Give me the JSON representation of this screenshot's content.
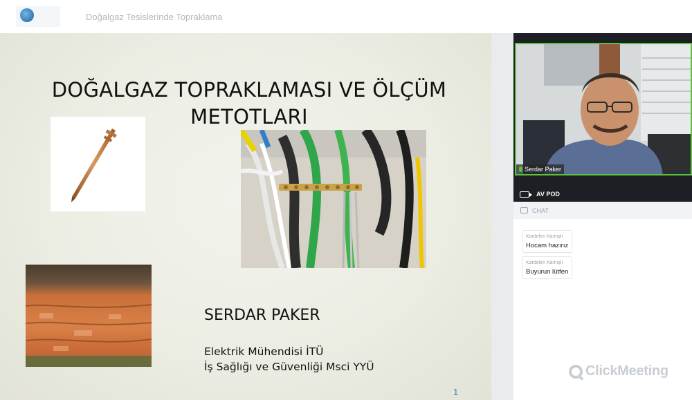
{
  "header": {
    "title": "Doğalgaz Tesislerinde Topraklama",
    "logo_icon": "globe-logo-icon"
  },
  "slide": {
    "title_line1": "DOĞALGAZ TOPRAKLAMASI VE ÖLÇÜM",
    "title_line2": "METOTLARI",
    "author": "SERDAR PAKER",
    "affiliation1": "Elektrik Mühendisi İTÜ",
    "affiliation2": "İş Sağlığı ve Güvenliği Msci YYÜ",
    "page_number": "1"
  },
  "video": {
    "speaker_name": "Serdar Paker",
    "label": "AV POD"
  },
  "chat": {
    "title": "CHAT",
    "messages": [
      {
        "sender": "Kardelen Kamışlı",
        "text": "Hocam hazırız"
      },
      {
        "sender": "Kardelen Kamışlı",
        "text": "Buyurun lütfen"
      }
    ]
  },
  "watermark": {
    "text": "ClickMeeting"
  },
  "colors": {
    "accent_green": "#59c43a",
    "page_number_blue": "#2f80c4"
  }
}
